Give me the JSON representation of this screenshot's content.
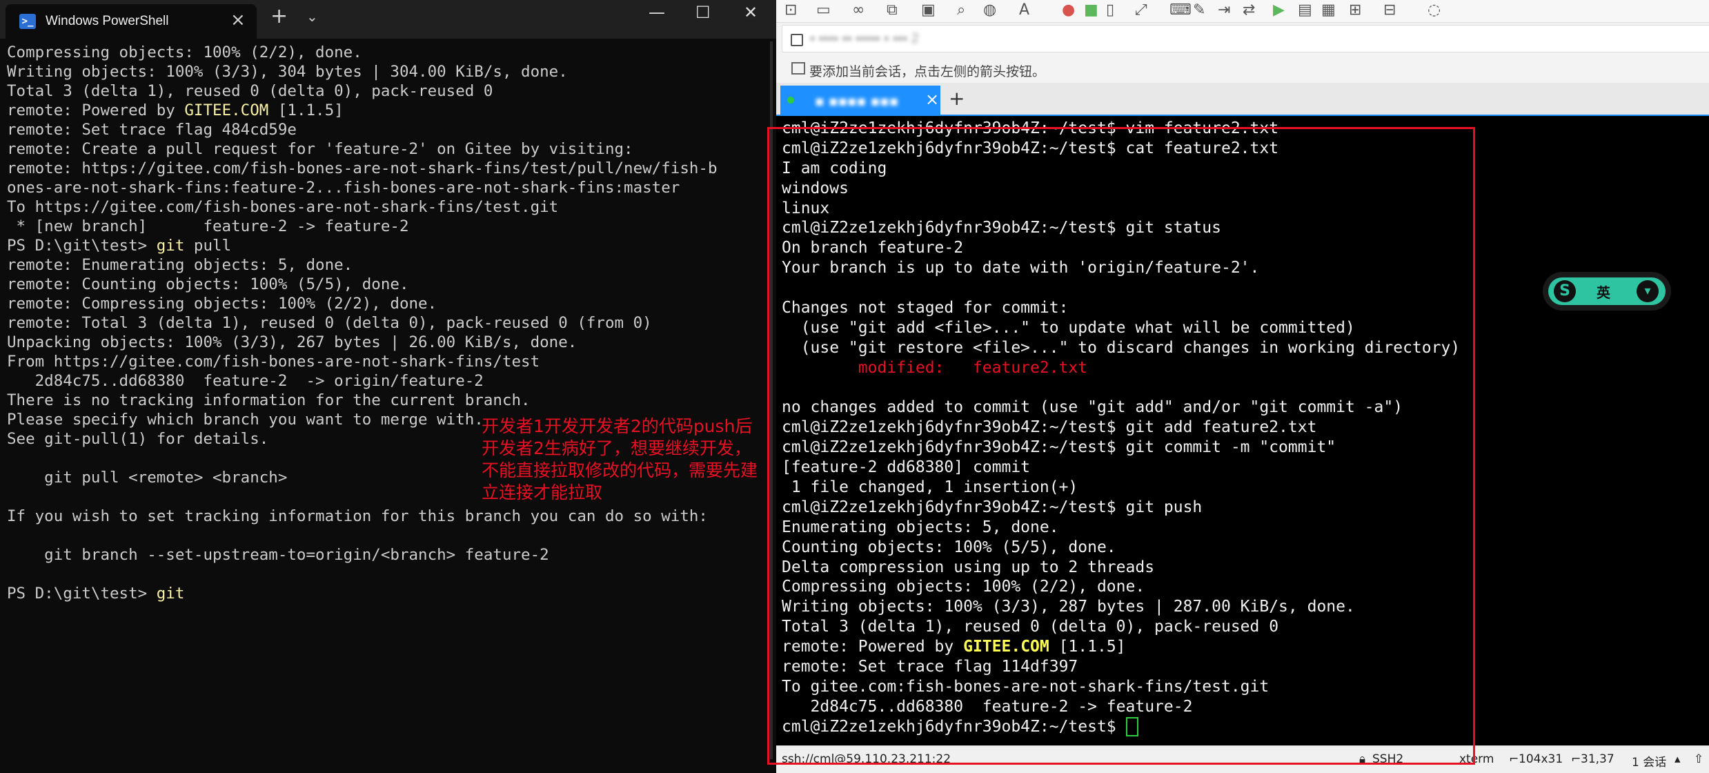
{
  "powershell": {
    "tab_title": "Windows PowerShell",
    "tab_icon": "powershell-icon",
    "lines": [
      [
        {
          "t": "Compressing objects: 100% (2/2), done."
        }
      ],
      [
        {
          "t": "Writing objects: 100% (3/3), 304 bytes | 304.00 KiB/s, done."
        }
      ],
      [
        {
          "t": "Total 3 (delta 1), reused 0 (delta 0), pack-reused 0"
        }
      ],
      [
        {
          "t": "remote: Powered by "
        },
        {
          "t": "GITEE.COM",
          "c": "yl"
        },
        {
          "t": " [1.1.5]"
        }
      ],
      [
        {
          "t": "remote: Set trace flag 484cd59e"
        }
      ],
      [
        {
          "t": "remote: Create a pull request for 'feature-2' on Gitee by visiting:"
        }
      ],
      [
        {
          "t": "remote: https://gitee.com/fish-bones-are-not-shark-fins/test/pull/new/fish-b"
        }
      ],
      [
        {
          "t": "ones-are-not-shark-fins:feature-2...fish-bones-are-not-shark-fins:master"
        }
      ],
      [
        {
          "t": "To https://gitee.com/fish-bones-are-not-shark-fins/test.git"
        }
      ],
      [
        {
          "t": " * [new branch]      feature-2 -> feature-2"
        }
      ],
      [
        {
          "t": "PS D:\\git\\test> "
        },
        {
          "t": "git",
          "c": "yl"
        },
        {
          "t": " pull"
        }
      ],
      [
        {
          "t": "remote: Enumerating objects: 5, done."
        }
      ],
      [
        {
          "t": "remote: Counting objects: 100% (5/5), done."
        }
      ],
      [
        {
          "t": "remote: Compressing objects: 100% (2/2), done."
        }
      ],
      [
        {
          "t": "remote: Total 3 (delta 1), reused 0 (delta 0), pack-reused 0 (from 0)"
        }
      ],
      [
        {
          "t": "Unpacking objects: 100% (3/3), 267 bytes | 26.00 KiB/s, done."
        }
      ],
      [
        {
          "t": "From https://gitee.com/fish-bones-are-not-shark-fins/test"
        }
      ],
      [
        {
          "t": "   2d84c75..dd68380  feature-2  -> origin/feature-2"
        }
      ],
      [
        {
          "t": "There is no tracking information for the current branch."
        }
      ],
      [
        {
          "t": "Please specify which branch you want to merge with."
        }
      ],
      [
        {
          "t": "See git-pull(1) for details."
        }
      ],
      [
        {
          "t": ""
        }
      ],
      [
        {
          "t": "    git pull <remote> <branch>"
        }
      ],
      [
        {
          "t": ""
        }
      ],
      [
        {
          "t": "If you wish to set tracking information for this branch you can do so with:"
        }
      ],
      [
        {
          "t": ""
        }
      ],
      [
        {
          "t": "    git branch --set-upstream-to=origin/<branch> feature-2"
        }
      ],
      [
        {
          "t": ""
        }
      ],
      [
        {
          "t": "PS D:\\git\\test> "
        },
        {
          "t": "git",
          "c": "yl"
        }
      ]
    ]
  },
  "annotation": "开发者1开发开发者2的代码push后\n开发者2生病好了，想要继续开发，\n不能直接拉取修改的代码，需要先建\n立连接才能拉取",
  "ssh": {
    "address_text": "▪ ▪▪▪▪ ▪▪ ▪▪▪▪▪ ▪ ▪▪▪ 2",
    "hint": "要添加当前会话，点击左侧的箭头按钮。",
    "tab_title": "▪ ▪▪▪▪ ▪▪▪",
    "lines": [
      [
        {
          "t": "cml@iZ2ze1zekhj6dyfnr39ob4Z:~/test$ vim feature2.txt"
        }
      ],
      [
        {
          "t": "cml@iZ2ze1zekhj6dyfnr39ob4Z:~/test$ cat feature2.txt"
        }
      ],
      [
        {
          "t": "I am coding"
        }
      ],
      [
        {
          "t": "windows"
        }
      ],
      [
        {
          "t": "linux"
        }
      ],
      [
        {
          "t": "cml@iZ2ze1zekhj6dyfnr39ob4Z:~/test$ git status"
        }
      ],
      [
        {
          "t": "On branch feature-2"
        }
      ],
      [
        {
          "t": "Your branch is up to date with 'origin/feature-2'."
        }
      ],
      [
        {
          "t": ""
        }
      ],
      [
        {
          "t": "Changes not staged for commit:"
        }
      ],
      [
        {
          "t": "  (use \"git add <file>...\" to update what will be committed)"
        }
      ],
      [
        {
          "t": "  (use \"git restore <file>...\" to discard changes in working directory)"
        }
      ],
      [
        {
          "t": "        "
        },
        {
          "t": "modified:   feature2.txt",
          "c": "rd"
        }
      ],
      [
        {
          "t": ""
        }
      ],
      [
        {
          "t": "no changes added to commit (use \"git add\" and/or \"git commit -a\")"
        }
      ],
      [
        {
          "t": "cml@iZ2ze1zekhj6dyfnr39ob4Z:~/test$ git add feature2.txt"
        }
      ],
      [
        {
          "t": "cml@iZ2ze1zekhj6dyfnr39ob4Z:~/test$ git commit -m \"commit\""
        }
      ],
      [
        {
          "t": "[feature-2 dd68380] commit"
        }
      ],
      [
        {
          "t": " 1 file changed, 1 insertion(+)"
        }
      ],
      [
        {
          "t": "cml@iZ2ze1zekhj6dyfnr39ob4Z:~/test$ git push"
        }
      ],
      [
        {
          "t": "Enumerating objects: 5, done."
        }
      ],
      [
        {
          "t": "Counting objects: 100% (5/5), done."
        }
      ],
      [
        {
          "t": "Delta compression using up to 2 threads"
        }
      ],
      [
        {
          "t": "Compressing objects: 100% (2/2), done."
        }
      ],
      [
        {
          "t": "Writing objects: 100% (3/3), 287 bytes | 287.00 KiB/s, done."
        }
      ],
      [
        {
          "t": "Total 3 (delta 1), reused 0 (delta 0), pack-reused 0"
        }
      ],
      [
        {
          "t": "remote: Powered by "
        },
        {
          "t": "GITEE.COM",
          "c": "by"
        },
        {
          "t": " [1.1.5]"
        }
      ],
      [
        {
          "t": "remote: Set trace flag 114df397"
        }
      ],
      [
        {
          "t": "To gitee.com:fish-bones-are-not-shark-fins/test.git"
        }
      ],
      [
        {
          "t": "   2d84c75..dd68380  feature-2 -> feature-2"
        }
      ],
      [
        {
          "t": "cml@iZ2ze1zekhj6dyfnr39ob4Z:~/test$ "
        }
      ]
    ],
    "status": {
      "connection": "ssh://cml@59.110.23.211:22",
      "protocol": "SSH2",
      "terminal": "xterm",
      "size": "104x31",
      "cursor": "31,37",
      "sessions": "1 会话"
    }
  },
  "ime": {
    "label": "英"
  },
  "colors": {
    "highlight": "#e81123",
    "accent": "#1e90ff",
    "ime": "#2ec4a2"
  }
}
